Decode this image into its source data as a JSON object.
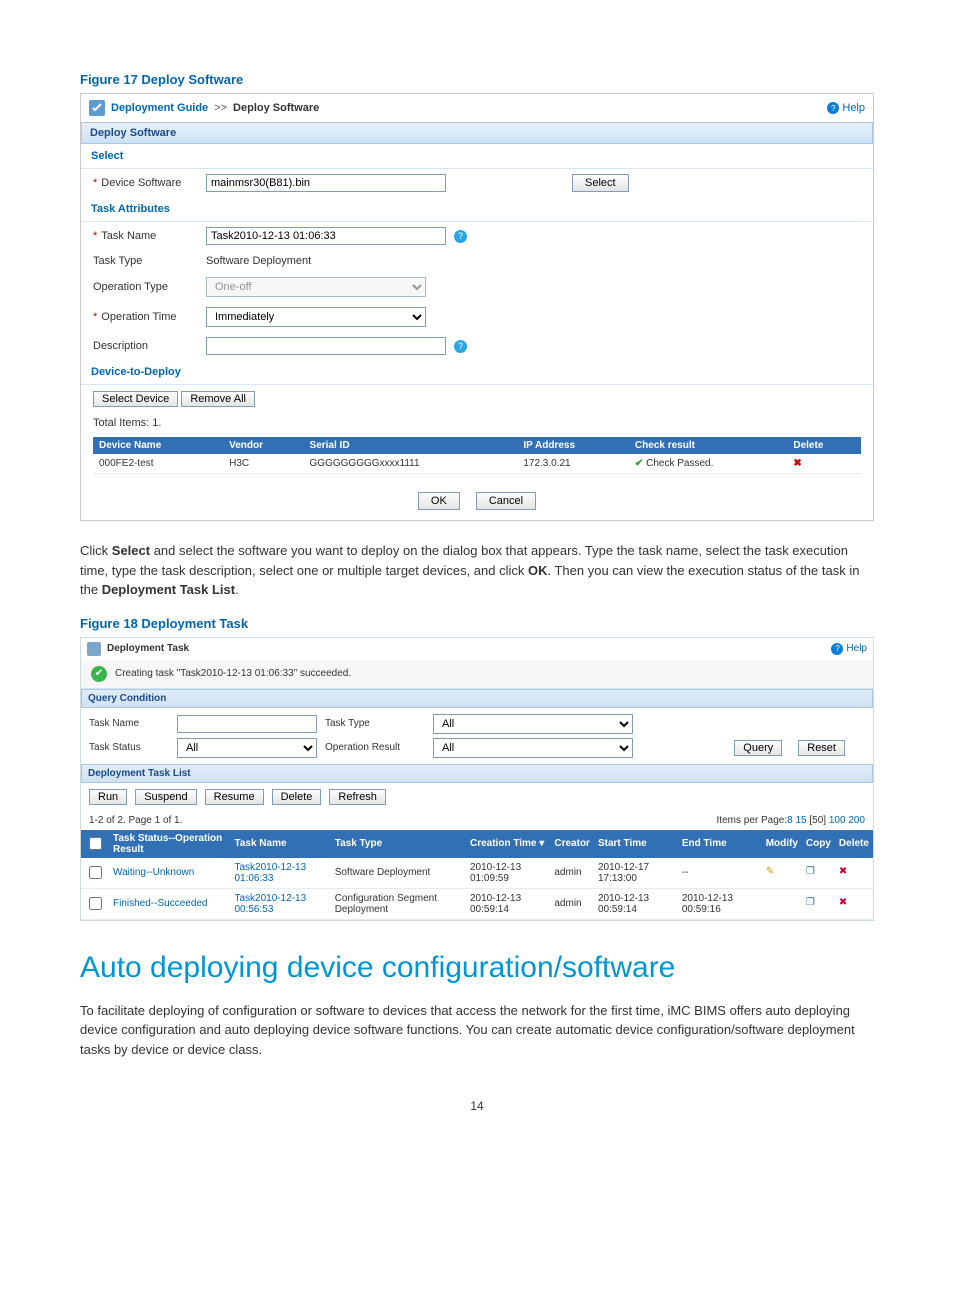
{
  "fig17_caption": "Figure 17 Deploy Software",
  "bc": {
    "link": "Deployment Guide",
    "sep": ">>",
    "current": "Deploy Software",
    "help": "Help"
  },
  "panel1_title": "Deploy Software",
  "select_sec": "Select",
  "device_software_label": "Device Software",
  "device_software_value": "mainmsr30(B81).bin",
  "select_btn": "Select",
  "task_attr_sec": "Task Attributes",
  "task_name_label": "Task Name",
  "task_name_value": "Task2010-12-13 01:06:33",
  "task_type_label": "Task Type",
  "task_type_value": "Software Deployment",
  "op_type_label": "Operation Type",
  "op_type_value": "One-off",
  "op_time_label": "Operation Time",
  "op_time_value": "Immediately",
  "desc_label": "Description",
  "desc_value": "",
  "d2d_sec": "Device-to-Deploy",
  "select_device_btn": "Select Device",
  "remove_all_btn": "Remove All",
  "total_items": "Total Items: 1.",
  "tbl1": {
    "h1": "Device Name",
    "h2": "Vendor",
    "h3": "Serial ID",
    "h4": "IP Address",
    "h5": "Check result",
    "h6": "Delete",
    "r1c1": "000FE2-test",
    "r1c2": "H3C",
    "r1c3": "GGGGGGGGGxxxx1111",
    "r1c4": "172.3.0.21",
    "r1c5": "Check Passed."
  },
  "ok_btn": "OK",
  "cancel_btn": "Cancel",
  "para1_a": "Click ",
  "para1_b": "Select",
  "para1_c": " and select the software you want to deploy on the dialog box that appears. Type the task name, select the task execution time, type the task description, select one or multiple target devices, and click ",
  "para1_d": "OK",
  "para1_e": ". Then you can view the execution status of the task in the ",
  "para1_f": "Deployment Task List",
  "para1_g": ".",
  "fig18_caption": "Figure 18 Deployment Task",
  "shot2": {
    "title": "Deployment Task",
    "help": "Help",
    "success_msg": "Creating task \"Task2010-12-13 01:06:33\" succeeded.",
    "qc_title": "Query Condition",
    "task_name_l": "Task Name",
    "task_type_l": "Task Type",
    "task_type_v": "All",
    "task_status_l": "Task Status",
    "task_status_v": "All",
    "op_result_l": "Operation Result",
    "op_result_v": "All",
    "query_btn": "Query",
    "reset_btn": "Reset",
    "list_title": "Deployment Task List",
    "run": "Run",
    "suspend": "Suspend",
    "resume": "Resume",
    "delete": "Delete",
    "refresh": "Refresh",
    "pager_left": "1-2 of 2. Page 1 of 1.",
    "pager_right_prefix": "Items per Page:",
    "pp1": "8",
    "pp2": "15",
    "pp3": "[50]",
    "pp4": "100",
    "pp5": "200",
    "th_chk": "",
    "th_status": "Task Status--Operation Result",
    "th_name": "Task Name",
    "th_type": "Task Type",
    "th_ctime": "Creation Time ▾",
    "th_creator": "Creator",
    "th_start": "Start Time",
    "th_end": "End Time",
    "th_mod": "Modify",
    "th_copy": "Copy",
    "th_del": "Delete",
    "r1_status": "Waiting--Unknown",
    "r1_name": "Task2010-12-13 01:06:33",
    "r1_type": "Software Deployment",
    "r1_ctime": "2010-12-13 01:09:59",
    "r1_creator": "admin",
    "r1_start": "2010-12-17 17:13:00",
    "r1_end": "--",
    "r2_status": "Finished--Succeeded",
    "r2_name": "Task2010-12-13 00:56:53",
    "r2_type": "Configuration Segment Deployment",
    "r2_ctime": "2010-12-13 00:59:14",
    "r2_creator": "admin",
    "r2_start": "2010-12-13 00:59:14",
    "r2_end": "2010-12-13 00:59:16"
  },
  "h1": "Auto deploying device configuration/software",
  "para2": "To facilitate deploying of configuration or software to devices that access the network for the first time, iMC BIMS offers auto deploying device configuration and auto deploying device software functions. You can create automatic device configuration/software deployment tasks by device or device class.",
  "page_num": "14"
}
